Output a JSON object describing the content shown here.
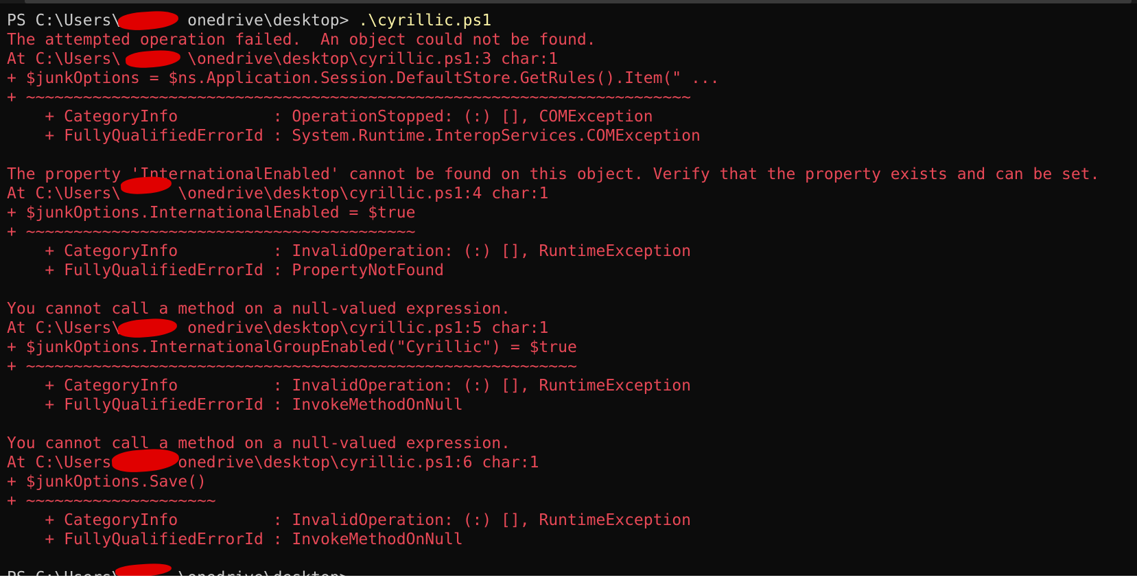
{
  "terminal": {
    "lines": [
      {
        "type": "prompt",
        "prompt": "PS C:\\Users\\       onedrive\\desktop> ",
        "command": ".\\cyrillic.ps1"
      },
      {
        "type": "error",
        "text": "The attempted operation failed.  An object could not be found."
      },
      {
        "type": "error",
        "text": "At C:\\Users\\       \\onedrive\\desktop\\cyrillic.ps1:3 char:1"
      },
      {
        "type": "error",
        "text": "+ $junkOptions = $ns.Application.Session.DefaultStore.GetRules().Item(\" ..."
      },
      {
        "type": "error",
        "text": "+ ~~~~~~~~~~~~~~~~~~~~~~~~~~~~~~~~~~~~~~~~~~~~~~~~~~~~~~~~~~~~~~~~~~~~~~"
      },
      {
        "type": "error",
        "text": "    + CategoryInfo          : OperationStopped: (:) [], COMException"
      },
      {
        "type": "error",
        "text": "    + FullyQualifiedErrorId : System.Runtime.InteropServices.COMException"
      },
      {
        "type": "blank",
        "text": ""
      },
      {
        "type": "error",
        "text": "The property 'InternationalEnabled' cannot be found on this object. Verify that the property exists and can be set."
      },
      {
        "type": "error",
        "text": "At C:\\Users\\      \\onedrive\\desktop\\cyrillic.ps1:4 char:1"
      },
      {
        "type": "error",
        "text": "+ $junkOptions.InternationalEnabled = $true"
      },
      {
        "type": "error",
        "text": "+ ~~~~~~~~~~~~~~~~~~~~~~~~~~~~~~~~~~~~~~~~~"
      },
      {
        "type": "error",
        "text": "    + CategoryInfo          : InvalidOperation: (:) [], RuntimeException"
      },
      {
        "type": "error",
        "text": "    + FullyQualifiedErrorId : PropertyNotFound"
      },
      {
        "type": "blank",
        "text": ""
      },
      {
        "type": "error",
        "text": "You cannot call a method on a null-valued expression."
      },
      {
        "type": "error",
        "text": "At C:\\Users\\       onedrive\\desktop\\cyrillic.ps1:5 char:1"
      },
      {
        "type": "error",
        "text": "+ $junkOptions.InternationalGroupEnabled(\"Cyrillic\") = $true"
      },
      {
        "type": "error",
        "text": "+ ~~~~~~~~~~~~~~~~~~~~~~~~~~~~~~~~~~~~~~~~~~~~~~~~~~~~~~~~~~"
      },
      {
        "type": "error",
        "text": "    + CategoryInfo          : InvalidOperation: (:) [], RuntimeException"
      },
      {
        "type": "error",
        "text": "    + FullyQualifiedErrorId : InvokeMethodOnNull"
      },
      {
        "type": "blank",
        "text": ""
      },
      {
        "type": "error",
        "text": "You cannot call a method on a null-valued expression."
      },
      {
        "type": "error",
        "text": "At C:\\Users       onedrive\\desktop\\cyrillic.ps1:6 char:1"
      },
      {
        "type": "error",
        "text": "+ $junkOptions.Save()"
      },
      {
        "type": "error",
        "text": "+ ~~~~~~~~~~~~~~~~~~~~"
      },
      {
        "type": "error",
        "text": "    + CategoryInfo          : InvalidOperation: (:) [], RuntimeException"
      },
      {
        "type": "error",
        "text": "    + FullyQualifiedErrorId : InvokeMethodOnNull"
      },
      {
        "type": "blank",
        "text": ""
      },
      {
        "type": "prompt",
        "prompt": "PS C:\\Users\\      \\onedrive\\desktop>",
        "command": ""
      }
    ]
  },
  "colors": {
    "background": "#0c0c0c",
    "prompt_text": "#cccccc",
    "command_text": "#f9f1a5",
    "error_text": "#e74856",
    "redaction": "#e00000"
  }
}
